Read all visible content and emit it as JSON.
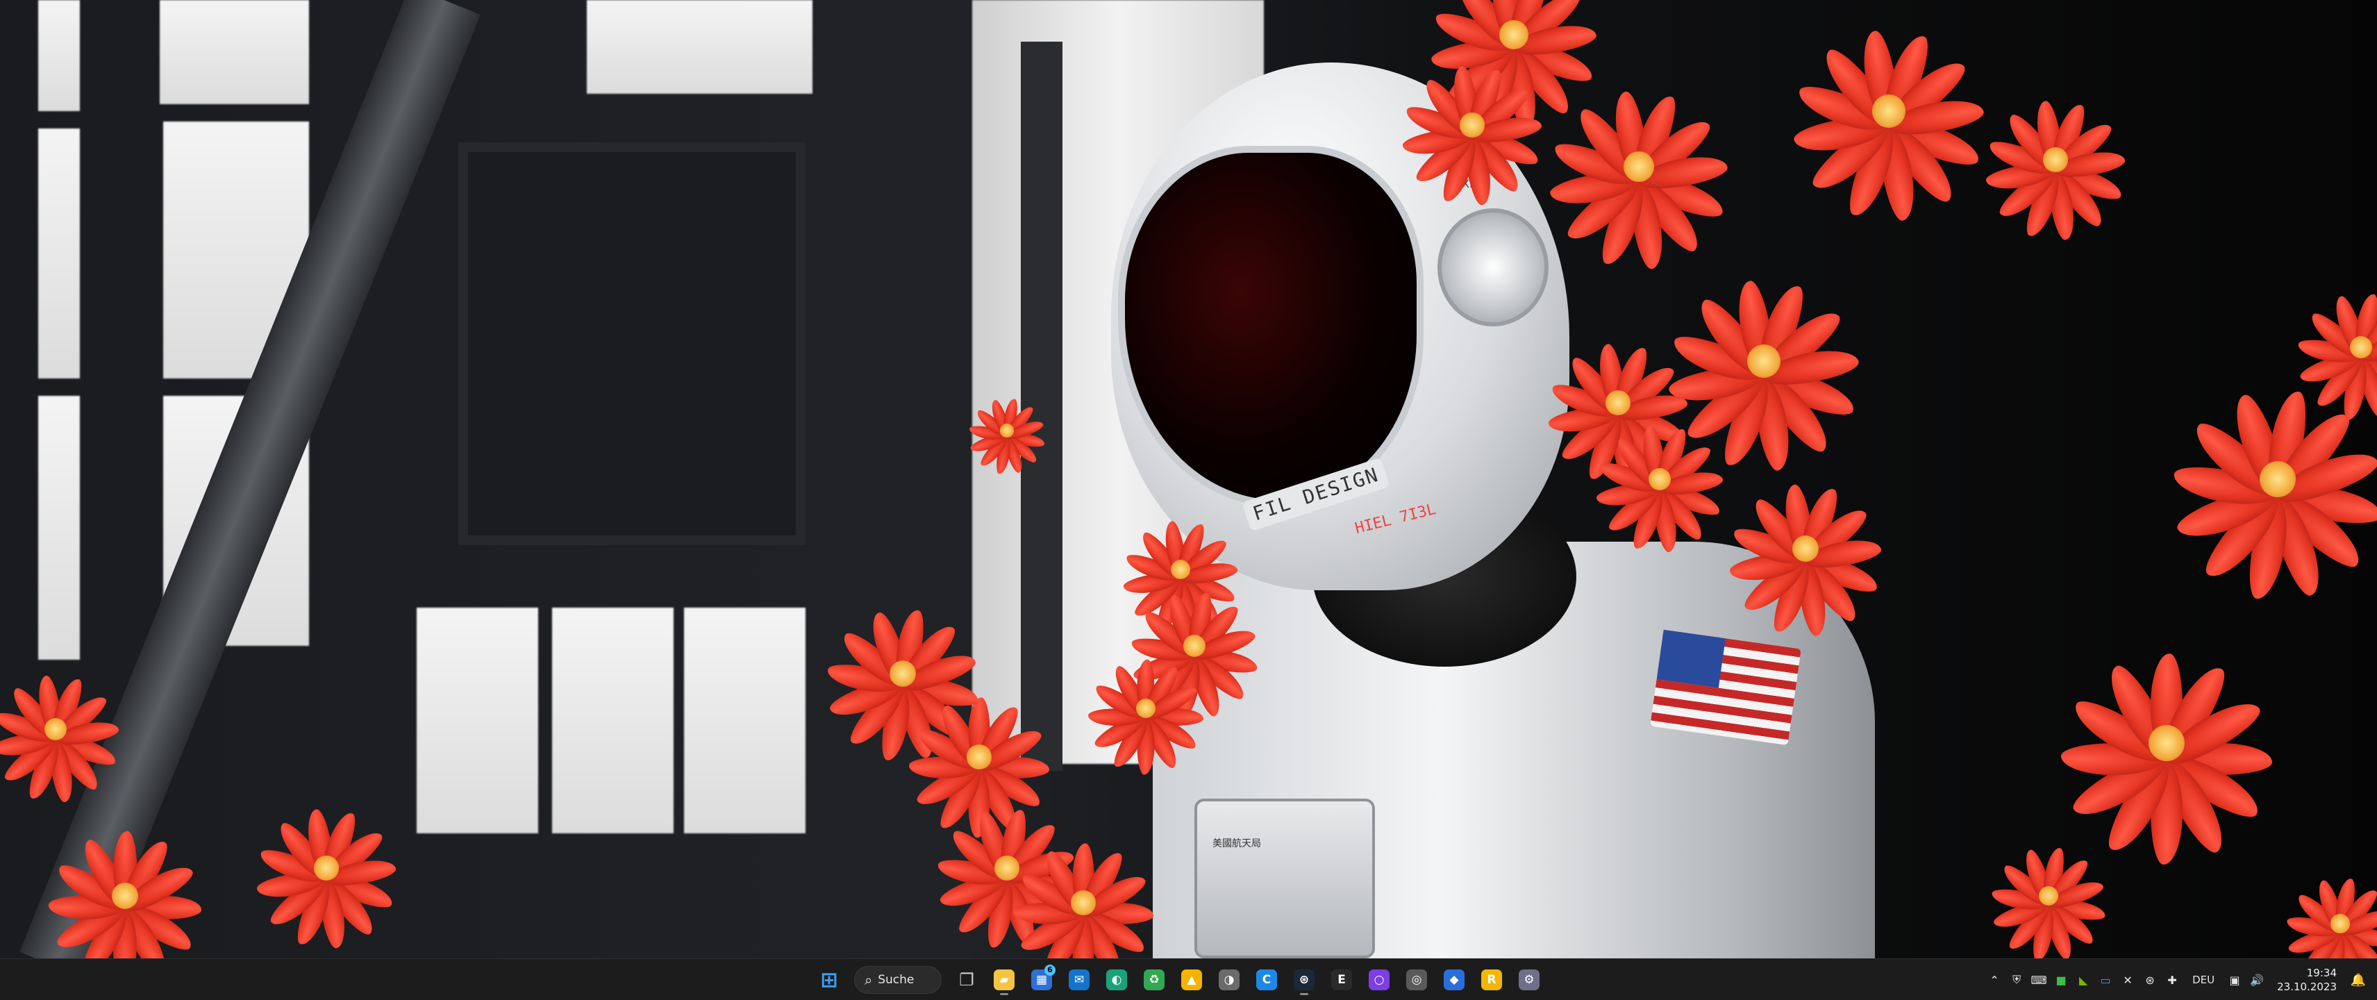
{
  "wallpaper": {
    "helmet_text": "FIL DESIGN",
    "helmet_subtext": "HIEL 7I3L",
    "helmet_size": "XL",
    "patch_text": "美國航天局"
  },
  "taskbar": {
    "search": {
      "label": "Suche",
      "icon": "search-icon"
    },
    "apps": [
      {
        "id": "start",
        "icon": "windows-logo-icon",
        "color": "#3aa0ff"
      },
      {
        "id": "task-view",
        "icon": "task-view-icon",
        "color": "#8c8c8c"
      },
      {
        "id": "file-explorer",
        "icon": "folder-icon",
        "color": "#f4c542",
        "running": true
      },
      {
        "id": "app-blue-badge",
        "icon": "app-grid-icon",
        "color": "#2f6fd6",
        "badge": "6"
      },
      {
        "id": "outlook",
        "icon": "mail-icon",
        "color": "#1573c9"
      },
      {
        "id": "edge",
        "icon": "edge-icon",
        "color": "#1aa37a"
      },
      {
        "id": "green-app",
        "icon": "green-app-icon",
        "color": "#33a852"
      },
      {
        "id": "yellow-app",
        "icon": "triangle-icon",
        "color": "#f4b400"
      },
      {
        "id": "copilot",
        "icon": "copilot-icon",
        "color": "#6b6b6b"
      },
      {
        "id": "c-app",
        "icon": "c-letter-icon",
        "color": "#1e88e5"
      },
      {
        "id": "steam",
        "icon": "steam-icon",
        "color": "#1b2838",
        "running": true
      },
      {
        "id": "epic",
        "icon": "epic-games-icon",
        "color": "#2a2a2a"
      },
      {
        "id": "purple-circle",
        "icon": "circle-icon",
        "color": "#7b3fe4"
      },
      {
        "id": "gray-circle",
        "icon": "disc-icon",
        "color": "#5a5a5a"
      },
      {
        "id": "blue-app",
        "icon": "blue-shield-icon",
        "color": "#2a6edb"
      },
      {
        "id": "rockstar",
        "icon": "rockstar-icon",
        "color": "#f2b705"
      },
      {
        "id": "settings-app",
        "icon": "gear-icon",
        "color": "#6f6f8a"
      }
    ],
    "tray": [
      {
        "id": "chevron",
        "icon": "chevron-up-icon"
      },
      {
        "id": "tray-1",
        "icon": "shield-icon"
      },
      {
        "id": "tray-2",
        "icon": "keyboard-icon"
      },
      {
        "id": "tray-3",
        "icon": "green-square-icon"
      },
      {
        "id": "tray-4",
        "icon": "nvidia-icon"
      },
      {
        "id": "tray-5",
        "icon": "monitor-icon"
      },
      {
        "id": "tray-6",
        "icon": "tool-icon"
      },
      {
        "id": "tray-7",
        "icon": "steam-small-icon"
      },
      {
        "id": "tray-8",
        "icon": "gamepad-icon"
      }
    ],
    "language": "DEU",
    "system": [
      {
        "id": "network",
        "icon": "monitor-network-icon"
      },
      {
        "id": "volume",
        "icon": "volume-icon"
      }
    ],
    "clock": {
      "time": "19:34",
      "date": "23.10.2023"
    },
    "notifications": {
      "icon": "bell-icon"
    }
  }
}
